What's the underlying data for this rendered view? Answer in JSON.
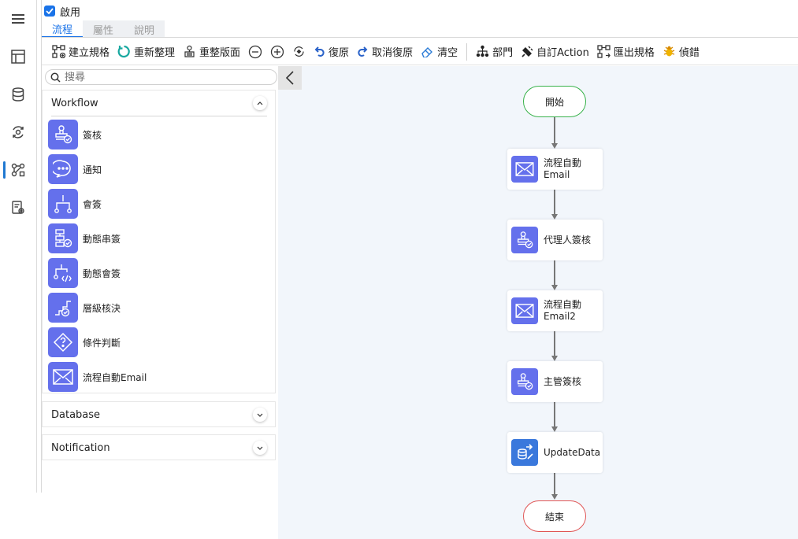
{
  "header": {
    "enable_label": "啟用",
    "enable_checked": true,
    "tabs": [
      {
        "label": "流程",
        "active": true
      },
      {
        "label": "屬性",
        "active": false
      },
      {
        "label": "說明",
        "active": false
      }
    ]
  },
  "toolbar": {
    "build_spec": "建立規格",
    "reorganize": "重新整理",
    "rearrange": "重整版面",
    "undo": "復原",
    "redo": "取消復原",
    "clear": "清空",
    "department": "部門",
    "custom_action": "自訂Action",
    "export_spec": "匯出規格",
    "debug": "偵錯"
  },
  "panel": {
    "search_placeholder": "搜尋",
    "sections": {
      "workflow": "Workflow",
      "database": "Database",
      "notification": "Notification"
    },
    "tools": [
      {
        "label": "簽核",
        "icon": "stamp-check-icon"
      },
      {
        "label": "通知",
        "icon": "chat-bubble-icon"
      },
      {
        "label": "會簽",
        "icon": "branch-icon"
      },
      {
        "label": "動態串簽",
        "icon": "dynamic-serial-icon"
      },
      {
        "label": "動態會簽",
        "icon": "dynamic-parallel-icon"
      },
      {
        "label": "層級核決",
        "icon": "stairs-check-icon"
      },
      {
        "label": "條件判斷",
        "icon": "diamond-question-icon"
      },
      {
        "label": "流程自動Email",
        "icon": "envelope-icon"
      }
    ]
  },
  "flow": {
    "start": "開始",
    "end": "結束",
    "nodes": [
      {
        "line1": "流程自動",
        "line2": "Email",
        "icon": "envelope-icon"
      },
      {
        "line1": "代理人簽核",
        "line2": "",
        "icon": "stamp-check-icon"
      },
      {
        "line1": "流程自動",
        "line2": "Email2",
        "icon": "envelope-icon"
      },
      {
        "line1": "主管簽核",
        "line2": "",
        "icon": "stamp-check-icon"
      },
      {
        "line1": "UpdateData",
        "line2": "",
        "icon": "database-edit-icon"
      }
    ]
  },
  "colors": {
    "accent": "#1a73e8",
    "tool_icon_bg": "#6470ec",
    "start_border": "#38b24a",
    "end_border": "#e05656",
    "canvas_bg": "#f2f6fb"
  }
}
